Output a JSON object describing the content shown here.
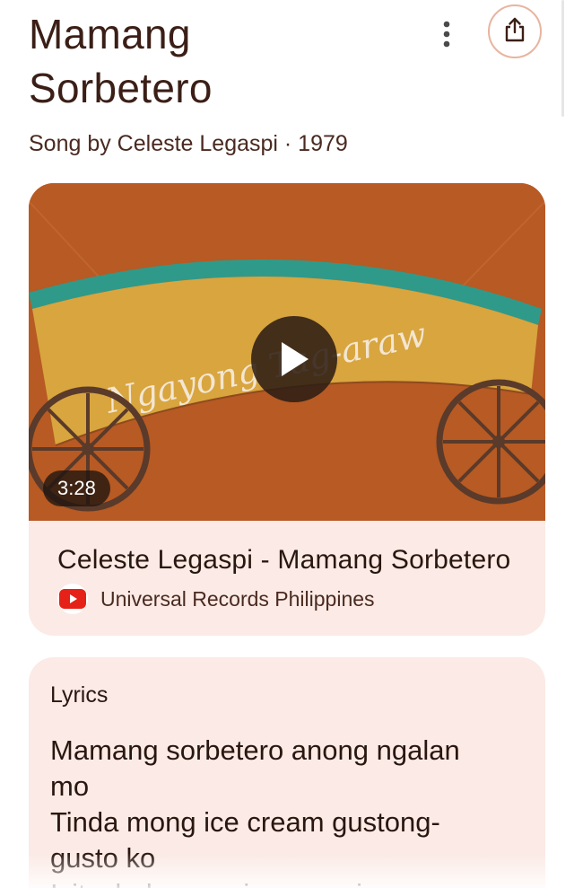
{
  "header": {
    "title_line1": "Mamang",
    "title_line2": "Sorbetero",
    "subtitle": "Song by Celeste Legaspi · 1979"
  },
  "actions": {
    "more_icon": "more-vert-icon",
    "share_icon": "share-icon"
  },
  "video": {
    "thumbnail_text": "Ngayong Tag-araw",
    "duration": "3:28",
    "title": "Celeste Legaspi - Mamang Sorbetero",
    "channel": "Universal Records Philippines",
    "channel_icon": "youtube-icon"
  },
  "lyrics": {
    "heading": "Lyrics",
    "lines": [
      "Mamang sorbetero anong ngalan mo",
      "Tinda mong ice cream gustong-gusto ko",
      "Isitsulad mo sa iyong mainam"
    ]
  },
  "colors": {
    "accent_border": "#e8b4a0",
    "card_bg": "#fbeae5",
    "thumb_bg": "#b75a23",
    "text": "#3b1f17",
    "youtube_red": "#e62117"
  }
}
